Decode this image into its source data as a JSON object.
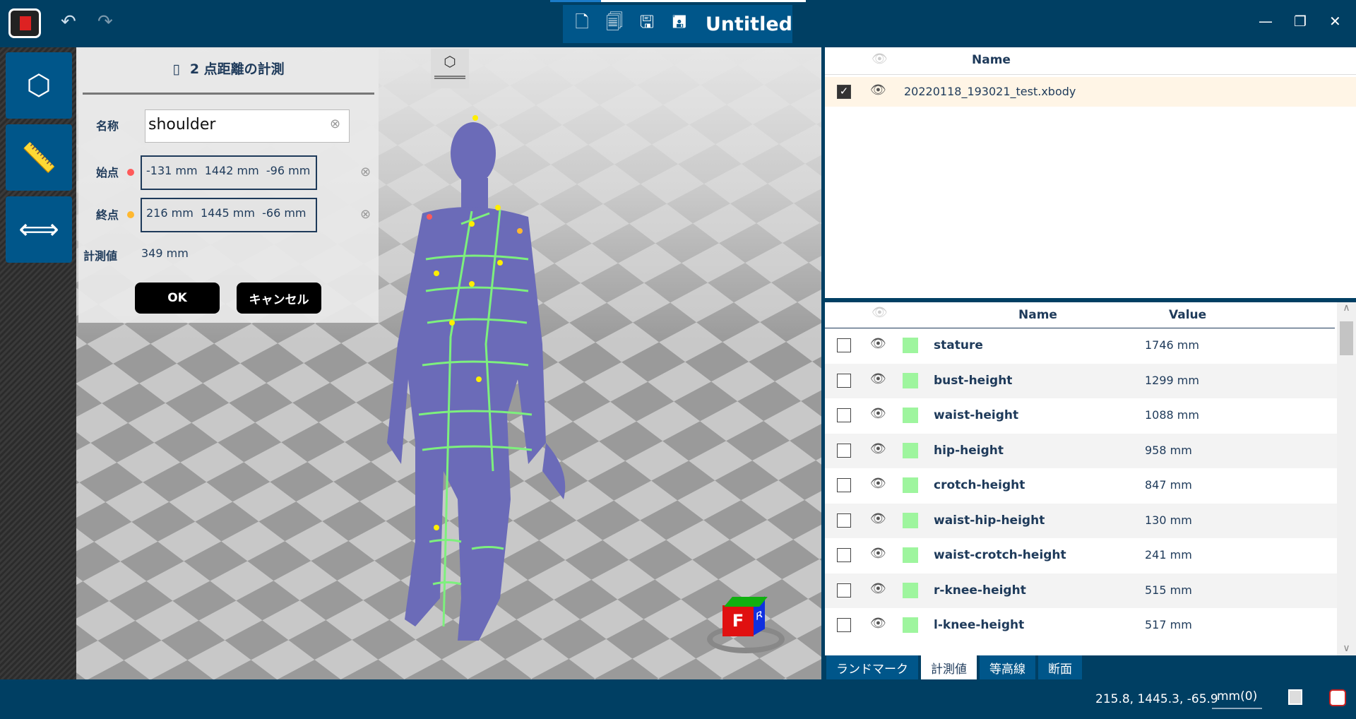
{
  "app": {
    "title": "Untitled",
    "icons": [
      "app-logo-icon",
      "undo-icon",
      "redo-icon",
      "new-file-icon",
      "open-file-icon",
      "save-icon",
      "save-as-icon",
      "minimize-icon",
      "restore-icon",
      "close-icon"
    ]
  },
  "left_tools": [
    "body-view-icon",
    "measure-ruler-icon",
    "two-point-distance-icon"
  ],
  "dialog": {
    "title": "2 点距離の計測",
    "name_label": "名称",
    "name_value": "shoulder",
    "start_label": "始点",
    "start_value": "-131 mm  1442 mm  -96 mm",
    "end_label": "終点",
    "end_value": "216 mm  1445 mm  -66 mm",
    "result_label": "計測値",
    "result_value": "349 mm",
    "ok": "OK",
    "cancel": "キャンセル",
    "start_color": "#ff5a5a",
    "end_color": "#ffb830"
  },
  "files": {
    "header_name": "Name",
    "rows": [
      {
        "checked": true,
        "name": "20220118_193021_test.xbody"
      }
    ]
  },
  "measurements": {
    "header_name": "Name",
    "header_value": "Value",
    "swatch_color": "#9ef59e",
    "rows": [
      {
        "name": "stature",
        "value": "1746 mm"
      },
      {
        "name": "bust-height",
        "value": "1299 mm"
      },
      {
        "name": "waist-height",
        "value": "1088 mm"
      },
      {
        "name": "hip-height",
        "value": "958 mm"
      },
      {
        "name": "crotch-height",
        "value": "847 mm"
      },
      {
        "name": "waist-hip-height",
        "value": "130 mm"
      },
      {
        "name": "waist-crotch-height",
        "value": "241 mm"
      },
      {
        "name": "r-knee-height",
        "value": "515 mm"
      },
      {
        "name": "l-knee-height",
        "value": "517 mm"
      }
    ]
  },
  "tabs": [
    {
      "label": "ランドマーク"
    },
    {
      "label": "計測値",
      "active": true
    },
    {
      "label": "等高線"
    },
    {
      "label": "断面"
    }
  ],
  "status": {
    "coords": "215.8, 1445.3, -65.9",
    "unit": "mm(0)"
  },
  "cube": {
    "front": "F",
    "right": "R"
  }
}
